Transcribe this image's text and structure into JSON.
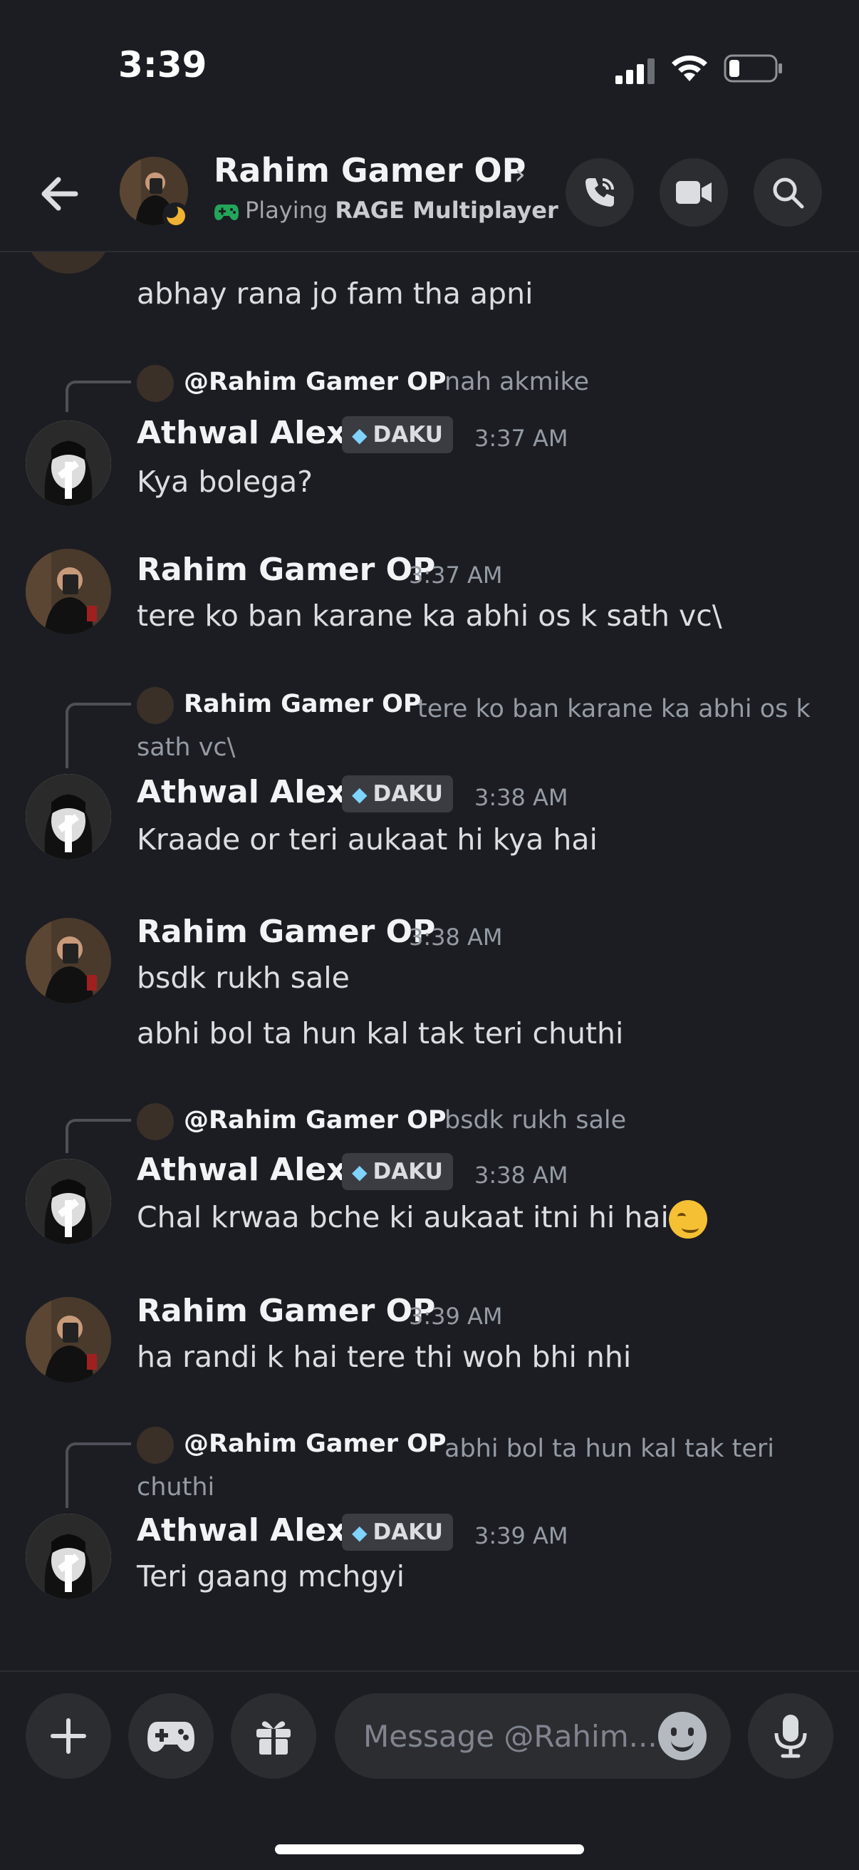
{
  "status_bar": {
    "time": "3:39"
  },
  "header": {
    "name": "Rahim Gamer OP",
    "activity_prefix": "Playing",
    "activity_game": "RAGE Multiplayer"
  },
  "messages": {
    "prev_text": "abhay rana jo fam tha apni",
    "r1": {
      "mention": "@Rahim Gamer OP",
      "preview": "nah akmike"
    },
    "m1": {
      "author": "Athwal Alexx",
      "tag": "DAKU",
      "time": "3:37 AM",
      "text": "Kya bolega?"
    },
    "m2": {
      "author": "Rahim Gamer OP",
      "time": "3:37 AM",
      "text": "tere ko ban karane ka abhi os k sath vc\\"
    },
    "r2": {
      "mention": "Rahim Gamer OP",
      "preview": "tere ko ban karane ka abhi os k sath vc\\"
    },
    "m3": {
      "author": "Athwal Alexx",
      "tag": "DAKU",
      "time": "3:38 AM",
      "text": "Kraade or teri aukaat hi kya hai"
    },
    "m4": {
      "author": "Rahim Gamer OP",
      "time": "3:38 AM",
      "text1": "bsdk rukh sale",
      "text2": "abhi bol ta hun kal tak teri chuthi"
    },
    "r3": {
      "mention": "@Rahim Gamer OP",
      "preview": "bsdk rukh sale"
    },
    "m5": {
      "author": "Athwal Alexx",
      "tag": "DAKU",
      "time": "3:38 AM",
      "text": "Chal krwaa bche ki aukaat itni hi hai"
    },
    "m6": {
      "author": "Rahim Gamer OP",
      "time": "3:39 AM",
      "text": "ha randi k hai tere thi woh bhi nhi"
    },
    "r4": {
      "mention": "@Rahim Gamer OP",
      "preview": "abhi bol ta hun kal tak teri chuthi"
    },
    "m7": {
      "author": "Athwal Alexx",
      "tag": "DAKU",
      "time": "3:39 AM",
      "text": "Teri gaang mchgyi"
    }
  },
  "composer": {
    "placeholder": "Message @Rahim..."
  },
  "colors": {
    "background": "#1c1d22",
    "surface": "#2b2d31",
    "muted_text": "#949ba4",
    "activity_icon": "#23a55a",
    "idle_moon": "#f0b232"
  },
  "icons": [
    "back-arrow-icon",
    "phone-call-icon",
    "video-camera-icon",
    "search-icon",
    "plus-icon",
    "gamepad-icon",
    "gift-icon",
    "emoji-icon",
    "microphone-icon",
    "diamond-icon"
  ]
}
